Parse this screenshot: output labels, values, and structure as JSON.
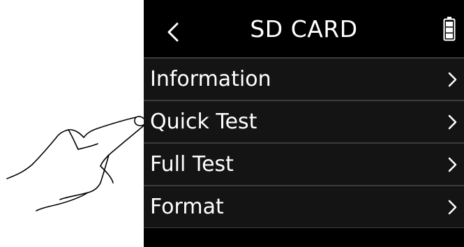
{
  "screen": {
    "title": "SD CARD",
    "back_icon": "chevron-left-icon",
    "battery_icon": "battery-full-icon"
  },
  "menu": {
    "items": [
      {
        "label": "Information",
        "icon": "chevron-right-icon"
      },
      {
        "label": "Quick Test",
        "icon": "chevron-right-icon"
      },
      {
        "label": "Full Test",
        "icon": "chevron-right-icon"
      },
      {
        "label": "Format",
        "icon": "chevron-right-icon"
      }
    ]
  },
  "colors": {
    "screen_bg": "#000000",
    "row_bg": "#141414",
    "divider": "#3c3c3c",
    "text": "#ffffff"
  }
}
